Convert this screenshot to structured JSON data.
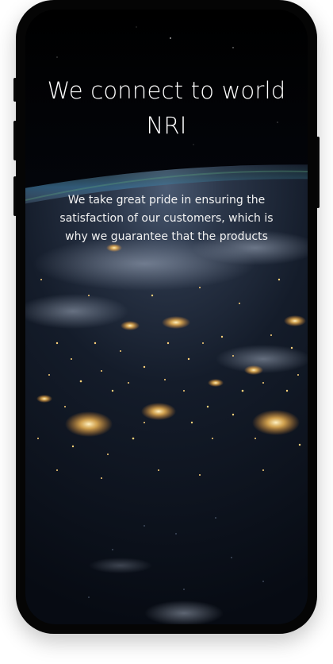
{
  "hero": {
    "title_line1": "We connect to world",
    "title_line2": "NRI",
    "description": "We take great pride in ensuring the satisfaction of our customers, which is why we guarantee that the products"
  },
  "colors": {
    "background": "#000000",
    "text": "#ffffff",
    "city_lights": "#ffcc66",
    "atmosphere": "#2e5a8c"
  }
}
